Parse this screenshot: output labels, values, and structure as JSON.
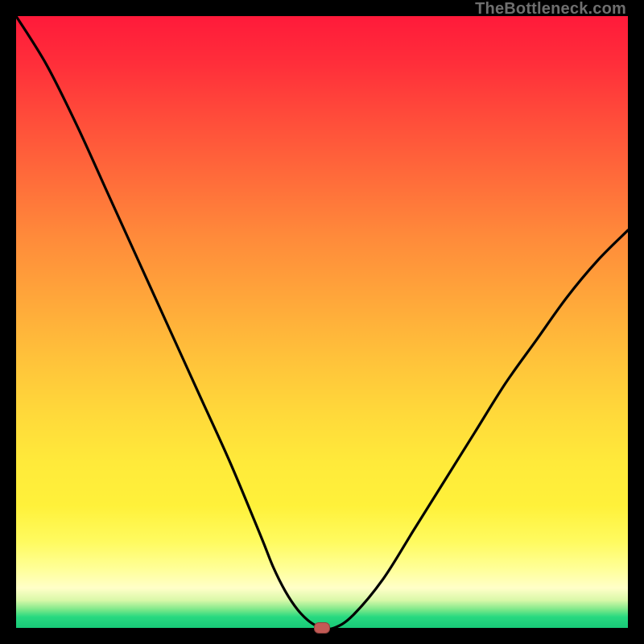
{
  "watermark": "TheBottleneck.com",
  "chart_data": {
    "type": "line",
    "title": "",
    "xlabel": "",
    "ylabel": "",
    "xlim": [
      0,
      100
    ],
    "ylim": [
      0,
      100
    ],
    "grid": false,
    "legend": false,
    "series": [
      {
        "name": "bottleneck-curve",
        "x": [
          0,
          5,
          10,
          15,
          20,
          25,
          30,
          35,
          40,
          42,
          44,
          46,
          48,
          50,
          52,
          55,
          60,
          65,
          70,
          75,
          80,
          85,
          90,
          95,
          100
        ],
        "values": [
          100,
          92,
          82,
          71,
          60,
          49,
          38,
          27,
          15,
          10,
          6,
          3,
          1,
          0,
          0,
          2,
          8,
          16,
          24,
          32,
          40,
          47,
          54,
          60,
          65
        ]
      }
    ],
    "background_gradient": {
      "top": "#ff1a3a",
      "mid": "#ffd93a",
      "bottom": "#18c978"
    },
    "marker": {
      "x": 50,
      "y": 0,
      "color": "#c35a55"
    }
  }
}
